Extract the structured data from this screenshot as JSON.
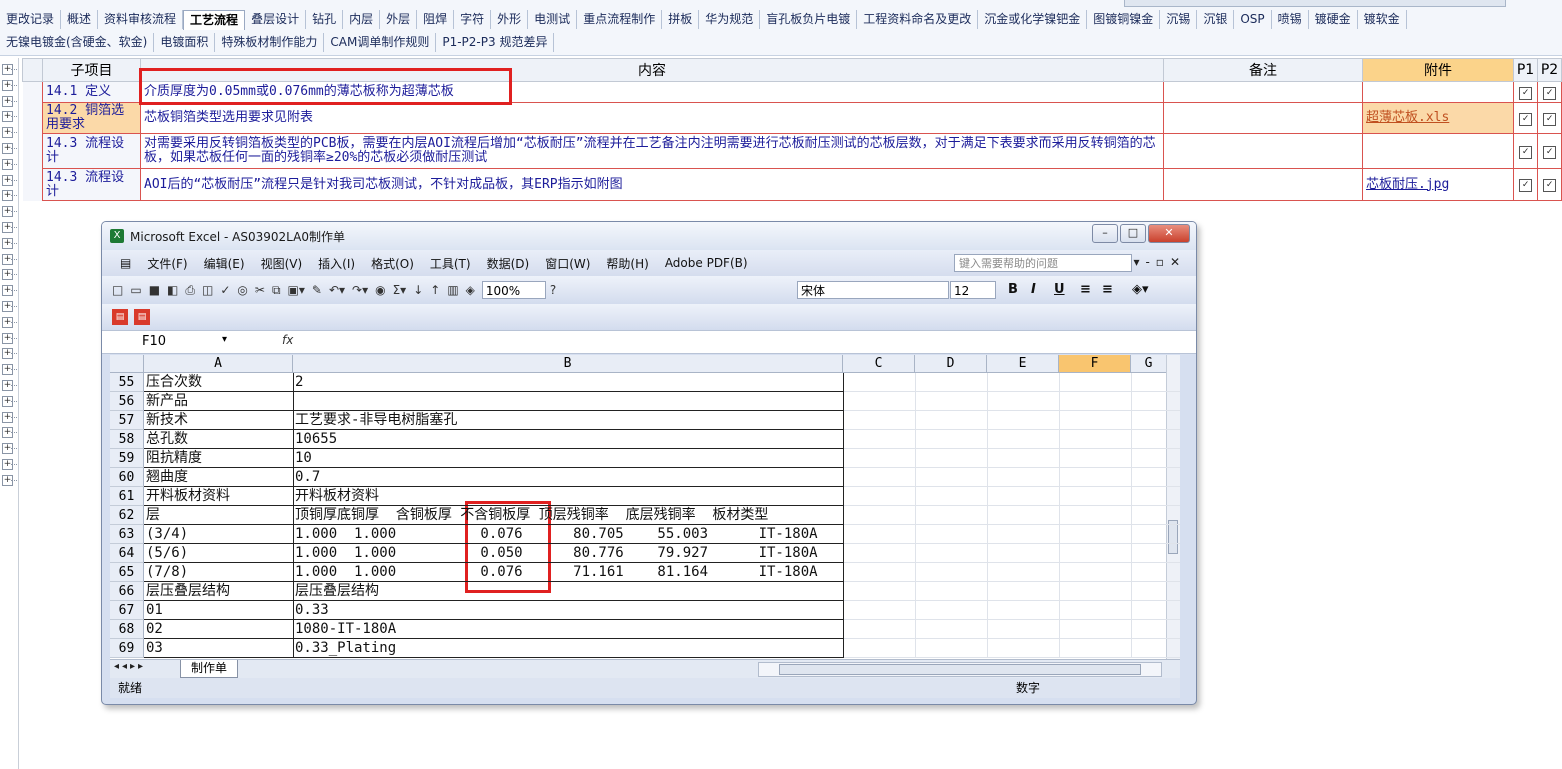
{
  "tabs": {
    "row1": [
      "更改记录",
      "概述",
      "资料审核流程",
      "工艺流程",
      "叠层设计",
      "钻孔",
      "内层",
      "外层",
      "阻焊",
      "字符",
      "外形",
      "电测试",
      "重点流程制作",
      "拼板",
      "华为规范",
      "盲孔板负片电镀",
      "工程资料命名及更改",
      "沉金或化学镍钯金",
      "图镀铜镍金",
      "沉锡",
      "沉银",
      "OSP",
      "喷锡",
      "镀硬金",
      "镀软金"
    ],
    "row2": [
      "无镍电镀金(含硬金、软金)",
      "电镀面积",
      "特殊板材制作能力",
      "CAM调单制作规则",
      "P1-P2-P3 规范差异"
    ],
    "active": "工艺流程"
  },
  "grid": {
    "headers": {
      "sub": "子项目",
      "content": "内容",
      "remark": "备注",
      "attachment": "附件",
      "p1": "P1",
      "p2": "P2"
    },
    "rows": [
      {
        "sub": "14.1 定义",
        "content": "介质厚度为0.05mm或0.076mm的薄芯板称为超薄芯板",
        "remark": "",
        "attachment": "",
        "p1": true,
        "p2": true
      },
      {
        "sub": "14.2 铜箔选用要求",
        "content": "芯板铜箔类型选用要求见附表",
        "remark": "",
        "attachment": "超薄芯板.xls",
        "p1": true,
        "p2": true
      },
      {
        "sub": "14.3 流程设计",
        "content": "对需要采用反转铜箔板类型的PCB板，需要在内层AOI流程后增加“芯板耐压”流程并在工艺备注内注明需要进行芯板耐压测试的芯板层数，对于满足下表要求而采用反转铜箔的芯板，如果芯板任何一面的残铜率≥20%的芯板必须做耐压测试",
        "remark": "",
        "attachment": "",
        "p1": true,
        "p2": true
      },
      {
        "sub": "14.3 流程设计",
        "content": "AOI后的“芯板耐压”流程只是针对我司芯板测试，不针对成品板，其ERP指示如附图",
        "remark": "",
        "attachment": "芯板耐压.jpg",
        "p1": true,
        "p2": true
      }
    ]
  },
  "excel": {
    "title": "Microsoft Excel - AS03902LA0制作单",
    "menu": [
      "文件(F)",
      "编辑(E)",
      "视图(V)",
      "插入(I)",
      "格式(O)",
      "工具(T)",
      "数据(D)",
      "窗口(W)",
      "帮助(H)",
      "Adobe PDF(B)"
    ],
    "help_placeholder": "键入需要帮助的问题",
    "zoom": "100%",
    "font": "宋体",
    "font_size": "12",
    "name_box": "F10",
    "fx": "fx",
    "columns": [
      "A",
      "B",
      "C",
      "D",
      "E",
      "F",
      "G"
    ],
    "selected_column": "F",
    "rows": [
      {
        "n": "55",
        "a": "压合次数",
        "b": "2"
      },
      {
        "n": "56",
        "a": "新产品",
        "b": ""
      },
      {
        "n": "57",
        "a": "新技术",
        "b": "工艺要求-非导电树脂塞孔"
      },
      {
        "n": "58",
        "a": "总孔数",
        "b": "10655"
      },
      {
        "n": "59",
        "a": "阻抗精度",
        "b": "10"
      },
      {
        "n": "60",
        "a": "翘曲度",
        "b": "0.7"
      },
      {
        "n": "61",
        "a": "开料板材资料",
        "b": "开料板材资料"
      },
      {
        "n": "62",
        "a": "层",
        "b": "顶铜厚底铜厚  含铜板厚 不含铜板厚 顶层残铜率  底层残铜率  板材类型"
      },
      {
        "n": "63",
        "a": "(3/4)",
        "b": "1.000  1.000          0.076      80.705    55.003      IT-180A"
      },
      {
        "n": "64",
        "a": "(5/6)",
        "b": "1.000  1.000          0.050      80.776    79.927      IT-180A"
      },
      {
        "n": "65",
        "a": "(7/8)",
        "b": "1.000  1.000          0.076      71.161    81.164      IT-180A"
      },
      {
        "n": "66",
        "a": "层压叠层结构",
        "b": "层压叠层结构"
      },
      {
        "n": "67",
        "a": "01",
        "b": "0.33"
      },
      {
        "n": "68",
        "a": "02",
        "b": "1080-IT-180A"
      },
      {
        "n": "69",
        "a": "03",
        "b": "0.33_Plating"
      }
    ],
    "sheet_tab": "制作单",
    "status_left": "就绪",
    "status_right": "数字"
  }
}
